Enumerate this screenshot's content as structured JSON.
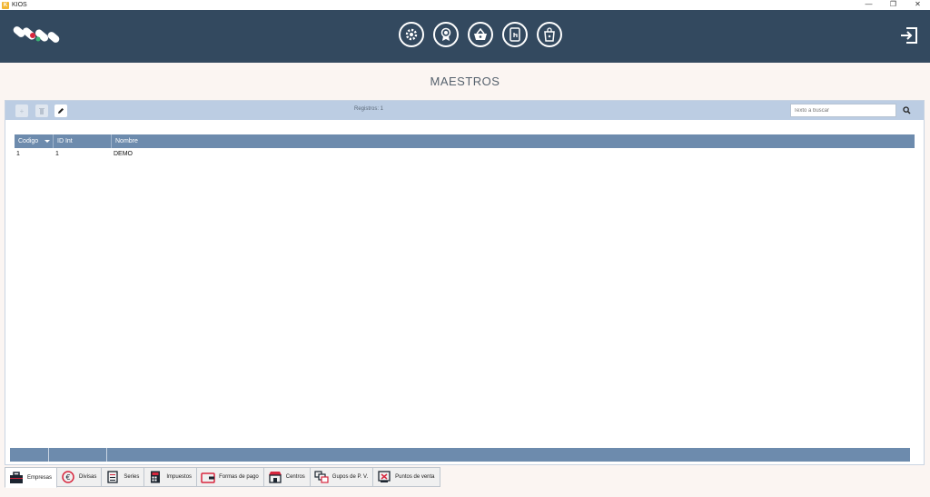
{
  "window": {
    "title": "KIOS",
    "icon_letter": "K",
    "minimize": "—",
    "restore": "❐",
    "close": "✕"
  },
  "header": {
    "nav": [
      {
        "icon": "gear-icon"
      },
      {
        "icon": "award-icon"
      },
      {
        "icon": "basket-icon"
      },
      {
        "icon": "touch-screen-icon"
      },
      {
        "icon": "shopping-bag-icon"
      }
    ],
    "logout_icon": "logout-icon"
  },
  "page": {
    "title": "MAESTROS"
  },
  "toolbar": {
    "add_label": "+",
    "delete_label": "🗑",
    "records_text": "Registros: 1",
    "search_placeholder": "Texto a buscar"
  },
  "grid": {
    "columns": [
      "Codigo",
      "ID Int",
      "Nombre"
    ],
    "rows": [
      [
        "1",
        "1",
        "DEMO"
      ]
    ]
  },
  "tabs": [
    {
      "label": "Empresas",
      "icon": "briefcase-icon",
      "active": true
    },
    {
      "label": "Divisas",
      "icon": "euro-icon",
      "active": false
    },
    {
      "label": "Series",
      "icon": "series-icon",
      "active": false
    },
    {
      "label": "Impuestos",
      "icon": "calculator-icon",
      "active": false
    },
    {
      "label": "Formas de pago",
      "icon": "wallet-icon",
      "active": false
    },
    {
      "label": "Centros",
      "icon": "store-icon",
      "active": false
    },
    {
      "label": "Gupos de P. V.",
      "icon": "groups-icon",
      "active": false
    },
    {
      "label": "Puntos de venta",
      "icon": "pos-icon",
      "active": false
    }
  ],
  "colors": {
    "header": "#33495f",
    "grid_header": "#6d8bad",
    "toolbar": "#bccde3",
    "accent_red": "#d7263d"
  }
}
